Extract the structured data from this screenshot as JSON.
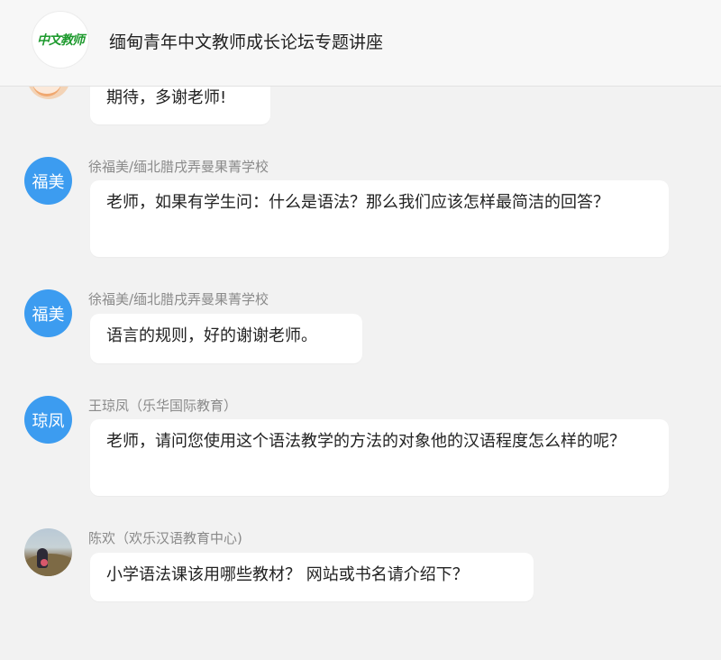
{
  "header": {
    "logo_text": "中文教师",
    "title": "缅甸青年中文教师成长论坛专题讲座"
  },
  "messages": [
    {
      "avatar_label": "",
      "author": "",
      "text": "期待，多谢老师!"
    },
    {
      "avatar_label": "福美",
      "author": "徐福美/缅北腊戌弄曼果菁学校",
      "text": "老师，如果有学生问：什么是语法？那么我们应该怎样最简洁的回答？"
    },
    {
      "avatar_label": "福美",
      "author": "徐福美/缅北腊戌弄曼果菁学校",
      "text": "语言的规则，好的谢谢老师。"
    },
    {
      "avatar_label": "琼凤",
      "author": "王琼凤（乐华国际教育）",
      "text": "老师，请问您使用这个语法教学的方法的对象他的汉语程度怎么样的呢？"
    },
    {
      "avatar_label": "",
      "author": "陈欢（欢乐汉语教育中心)",
      "text": "小学语法课该用哪些教材？ 网站或书名请介绍下？"
    }
  ],
  "colors": {
    "avatar_blue": "#3c9cf0",
    "logo_green": "#1e9a2e",
    "background": "#f2f2f2"
  }
}
